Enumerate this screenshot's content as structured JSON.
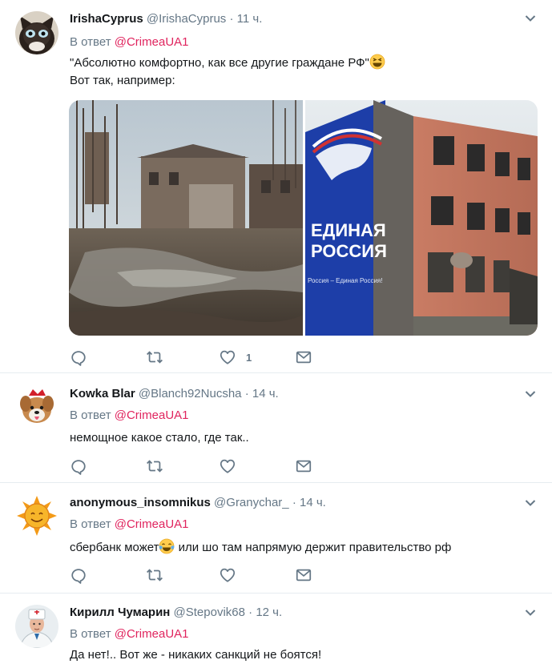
{
  "reply_prefix": "В ответ",
  "tweets": [
    {
      "name": "IrishaCyprus",
      "handle": "@IrishaCyprus",
      "time": "11 ч.",
      "reply_to": "@CrimeaUA1",
      "lines": [
        "\"Абсолютно комфортно, как все другие граждане РФ\"",
        "Вот так, например:"
      ],
      "like_count": "1",
      "has_media": true,
      "emoji_after_line": "grinning-squinting-emoji"
    },
    {
      "name": "Kowka Blar",
      "handle": "@Blanch92Nucsha",
      "time": "14 ч.",
      "reply_to": "@CrimeaUA1",
      "lines": [
        "немощное какое стало, где так.."
      ],
      "like_count": ""
    },
    {
      "name": "anonymous_insomnikus",
      "handle": "@Granychar_",
      "time": "14 ч.",
      "reply_to": "@CrimeaUA1",
      "lines": [
        "сбербанк может",
        " или шо там напрямую держит правительство рф"
      ],
      "like_count": "",
      "inline_emoji": "tears-of-joy-emoji"
    },
    {
      "name": "Кирилл Чумарин",
      "handle": "@Stepovik68",
      "time": "12 ч.",
      "reply_to": "@CrimeaUA1",
      "lines": [
        "Да нет!.. Вот же - никаких санкций не боятся!"
      ],
      "like_count": ""
    }
  ],
  "media_banner": {
    "line1": "ЕДИНАЯ",
    "line2": "РОССИЯ",
    "small": "Россия – Единая Россия!"
  },
  "colors": {
    "accent_mention": "#e0245e",
    "muted": "#657786",
    "divider": "#e6ecf0",
    "banner_blue": "#1d3ea8"
  },
  "icons": [
    "reply-icon",
    "retweet-icon",
    "like-icon",
    "dm-icon",
    "chevron-down-icon"
  ]
}
